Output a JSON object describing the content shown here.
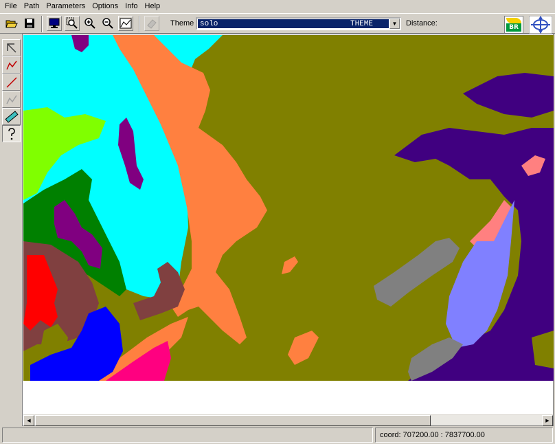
{
  "menu": {
    "items": [
      "File",
      "Path",
      "Parameters",
      "Options",
      "Info",
      "Help"
    ]
  },
  "toolbar": {
    "buttons": [
      "open-icon",
      "save-icon",
      "display-icon",
      "zoom-area-icon",
      "zoom-in-icon",
      "zoom-out-icon",
      "full-extent-icon",
      "eraser-icon"
    ],
    "theme_label": "Theme",
    "theme_value": "solo",
    "theme_type": "THEME",
    "distance_label": "Distance:",
    "logo_text": "BR"
  },
  "tools": [
    "pointer-icon",
    "polyline-icon",
    "line-icon",
    "path-icon",
    "ruler-icon",
    "help-icon"
  ],
  "map": {
    "colors": {
      "olive": "#808000",
      "cyan": "#00ffff",
      "orange": "#ff8040",
      "purple": "#800080",
      "indigo": "#400080",
      "green": "#008000",
      "lime": "#80ff00",
      "brown": "#804040",
      "red": "#ff0000",
      "blue": "#0000ff",
      "magenta": "#ff0080",
      "gray": "#808080",
      "lavender": "#8080ff",
      "salmon": "#ff8080"
    }
  },
  "status": {
    "left": "",
    "coord": "coord: 707200.00 : 7837700.00"
  }
}
